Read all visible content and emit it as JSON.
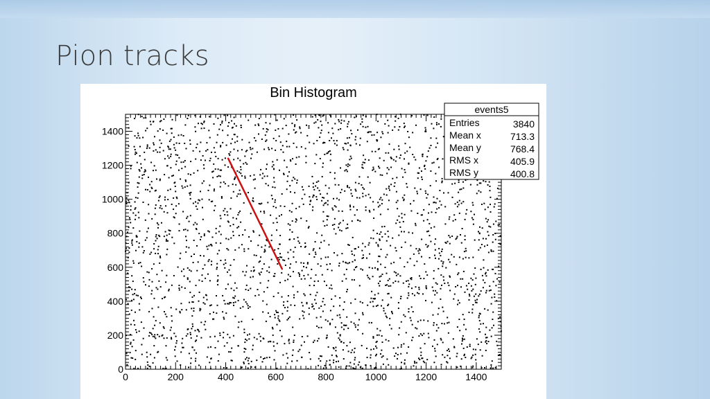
{
  "slide": {
    "title": "Pion tracks"
  },
  "chart_data": {
    "type": "scatter",
    "title": "Bin Histogram",
    "xlabel": "",
    "ylabel": "",
    "xlim": [
      0,
      1500
    ],
    "ylim": [
      0,
      1500
    ],
    "x_ticks": [
      "0",
      "200",
      "400",
      "600",
      "800",
      "1000",
      "1200",
      "1400"
    ],
    "y_ticks": [
      "0",
      "200",
      "400",
      "600",
      "800",
      "1000",
      "1200",
      "1400"
    ],
    "point_color": "#000000",
    "track": {
      "color": "#cc1111",
      "x": [
        410,
        625
      ],
      "y": [
        1240,
        590
      ]
    },
    "stats_box": {
      "name": "events5",
      "rows": [
        {
          "label": "Entries",
          "value": "3840"
        },
        {
          "label": "Mean x",
          "value": "713.3"
        },
        {
          "label": "Mean y",
          "value": "768.4"
        },
        {
          "label": "RMS x",
          "value": "405.9"
        },
        {
          "label": "RMS y",
          "value": "400.8"
        }
      ]
    }
  }
}
